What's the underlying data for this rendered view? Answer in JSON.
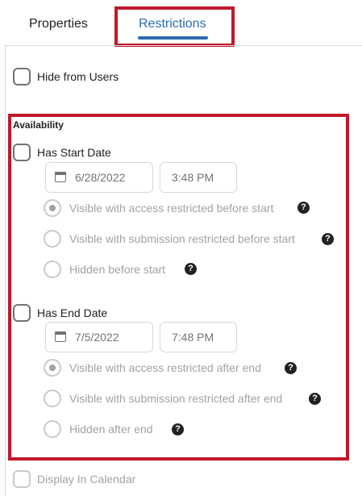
{
  "tabs": {
    "properties": "Properties",
    "restrictions": "Restrictions"
  },
  "hide_from_users": {
    "label": "Hide from Users",
    "checked": false
  },
  "availability": {
    "title": "Availability",
    "start": {
      "label": "Has Start Date",
      "checked": false,
      "date": "6/28/2022",
      "time": "3:48 PM",
      "options": [
        {
          "label": "Visible with access restricted before start",
          "selected": true
        },
        {
          "label": "Visible with submission restricted before start",
          "selected": false
        },
        {
          "label": "Hidden before start",
          "selected": false
        }
      ]
    },
    "end": {
      "label": "Has End Date",
      "checked": false,
      "date": "7/5/2022",
      "time": "7:48 PM",
      "options": [
        {
          "label": "Visible with access restricted after end",
          "selected": true
        },
        {
          "label": "Visible with submission restricted after end",
          "selected": false
        },
        {
          "label": "Hidden after end",
          "selected": false
        }
      ]
    }
  },
  "display_in_calendar": {
    "label": "Display In Calendar",
    "checked": false
  },
  "help_glyph": "?",
  "colors": {
    "highlight": "#c0182a",
    "tab_active": "#2b6cb0",
    "text": "#202122",
    "muted": "#6e7477"
  }
}
